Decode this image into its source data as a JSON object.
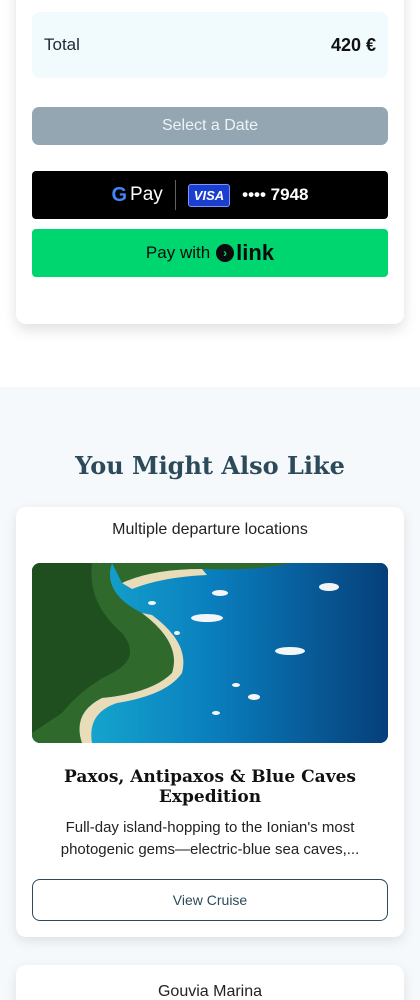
{
  "booking": {
    "total_label": "Total",
    "total_value": "420 €",
    "select_date_label": "Select a Date",
    "gpay": {
      "brand": "Pay",
      "card_brand": "VISA",
      "card_number": "•••• 7948"
    },
    "link_pay": {
      "prefix": "Pay with",
      "brand": "link"
    }
  },
  "recommendations": {
    "title": "You Might Also Like",
    "cards": [
      {
        "departure": "Multiple departure locations",
        "title": "Paxos, Antipaxos & Blue Caves Expedition",
        "description": "Full-day island-hopping to the Ionian's most photogenic gems—electric-blue sea caves,...",
        "button_label": "View Cruise"
      },
      {
        "departure": "Gouvia Marina"
      }
    ]
  },
  "colors": {
    "accent": "#2c4a5a",
    "link_green": "#00d66f",
    "select_date_bg": "#94a6b2",
    "total_bg": "#f1fafd"
  }
}
